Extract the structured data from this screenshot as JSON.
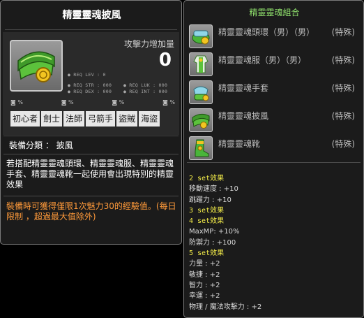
{
  "item": {
    "title": "精靈靈魂披風",
    "attack_label": "攻擊力增加量",
    "attack_value": "0",
    "req": {
      "lev": "● REQ LEV :  0",
      "str": "● REQ STR : 000",
      "luk": "● REQ LUK : 000",
      "dex": "● REQ DEX : 000",
      "int": "● REQ INT : 000"
    },
    "small_stats": [
      "%",
      "%",
      "%",
      "%"
    ],
    "jobs": [
      "初心者",
      "劍士",
      "法師",
      "弓箭手",
      "盜賊",
      "海盜"
    ],
    "category": "裝備分類 ： 披風",
    "description": "若搭配精靈靈魂頭環、精靈靈魂服、精靈靈魂手套、精靈靈魂靴一起使用會出現特別的精靈效果",
    "note": "裝備時可獲得僅限1次魅力30的經驗值。(每日限制 ，超過最大值除外)"
  },
  "set": {
    "title": "精靈靈魂組合",
    "items": [
      {
        "name": "精靈靈魂頭環（男）（男）",
        "tag": "(特殊)",
        "icon": "headband-icon"
      },
      {
        "name": "精靈靈魂服（男）（男）",
        "tag": "(特殊)",
        "icon": "robe-icon"
      },
      {
        "name": "精靈靈魂手套",
        "tag": "(特殊)",
        "icon": "glove-icon"
      },
      {
        "name": "精靈靈魂披風",
        "tag": "(特殊)",
        "icon": "cape-icon"
      },
      {
        "name": "精靈靈魂靴",
        "tag": "(特殊)",
        "icon": "boot-icon"
      }
    ],
    "effects": {
      "h2": "2 set效果",
      "e2a": "移動速度 : +10",
      "e2b": "跳躍力 : +10",
      "h3": "3 set效果",
      "h4": "4 set效果",
      "e4a": "MaxMP: +10%",
      "e4b": "防禦力 : +100",
      "h5": "5 set效果",
      "e5a": "力量 : +2",
      "e5b": "敏捷 : +2",
      "e5c": "智力 : +2",
      "e5d": "幸運 : +2",
      "e5e": "物理 / 魔法攻擊力 : +2"
    }
  }
}
